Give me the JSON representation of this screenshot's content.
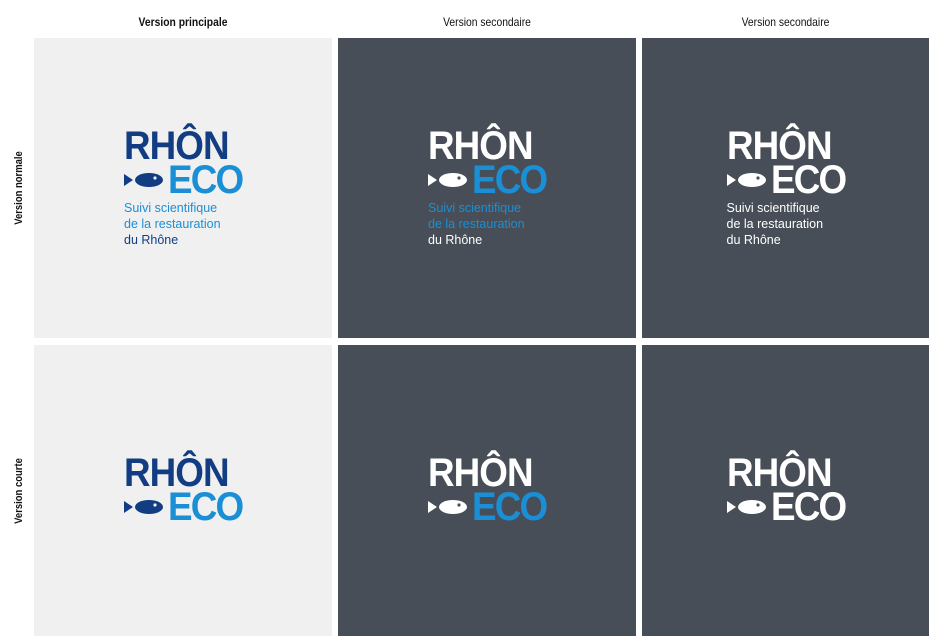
{
  "headers": {
    "col1": "Version principale",
    "col2": "Version secondaire",
    "col3": "Version secondaire",
    "row1": "Version normale",
    "row2": "Version courte"
  },
  "logo": {
    "word1": "RHÔN",
    "word2": "ECO",
    "tagline1": "Suivi scientifique",
    "tagline2": "de la restauration",
    "tagline3": "du Rhône"
  },
  "colors": {
    "navy": "#123d82",
    "blue": "#1a8fd6",
    "white": "#ffffff",
    "panel_light": "#f0f0f0",
    "panel_dark": "#474e57"
  },
  "icons": {
    "fish": "fish-icon"
  }
}
